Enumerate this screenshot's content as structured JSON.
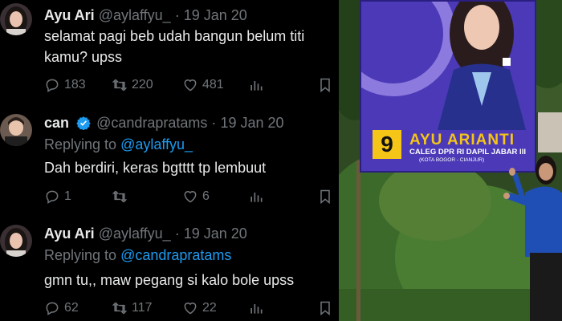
{
  "tweets": [
    {
      "name": "Ayu Ari",
      "handle": "@aylaffyu_",
      "dot": "·",
      "date": "19 Jan 20",
      "verified": false,
      "replying_prefix": "",
      "replying_to": "",
      "lines": [
        "selamat pagi beb udah bangun belum titi",
        "kamu? upss"
      ],
      "replies": "183",
      "retweets": "220",
      "likes": "481"
    },
    {
      "name": "can",
      "handle": "@candrapratams",
      "dot": "·",
      "date": "19 Jan 20",
      "verified": true,
      "replying_prefix": "Replying to",
      "replying_to": "@aylaffyu_",
      "lines": [
        "Dah berdiri, keras bgtttt tp lembuut"
      ],
      "replies": "1",
      "retweets": "",
      "likes": "6"
    },
    {
      "name": "Ayu Ari",
      "handle": "@aylaffyu_",
      "dot": "·",
      "date": "19 Jan 20",
      "verified": false,
      "replying_prefix": "Replying to",
      "replying_to": "@candrapratams",
      "lines": [
        "gmn tu,, maw pegang si kalo bole upss"
      ],
      "replies": "62",
      "retweets": "117",
      "likes": "22"
    }
  ],
  "photo": {
    "banner_number": "9",
    "banner_name": "AYU ARIANTI",
    "banner_subtitle": "CALEG DPR RI DAPIL JABAR III",
    "banner_subtitle2": "(KOTA BOGOR - CIANJUR)"
  },
  "colors": {
    "background": "#000000",
    "text": "#e7e9ea",
    "muted": "#71767b",
    "link": "#1d9bf0",
    "banner_purple": "#4b39b7",
    "banner_yellow": "#f5c518"
  }
}
